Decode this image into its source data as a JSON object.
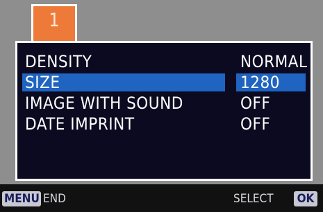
{
  "tab": {
    "number": "1",
    "color": "#ee7a3a"
  },
  "menu": {
    "items": [
      {
        "label": "DENSITY",
        "value": "NORMAL",
        "selected": false
      },
      {
        "label": "SIZE",
        "value": "1280",
        "selected": true
      },
      {
        "label": "IMAGE WITH SOUND",
        "value": "OFF",
        "selected": false
      },
      {
        "label": "DATE IMPRINT",
        "value": "OFF",
        "selected": false
      }
    ]
  },
  "footer": {
    "menu_button": "MENU",
    "menu_action": "END",
    "select_action": "SELECT",
    "ok_button": "OK"
  },
  "colors": {
    "highlight": "#1e64c0",
    "panel": "#0b0a20",
    "frame": "#8e8e8e"
  }
}
